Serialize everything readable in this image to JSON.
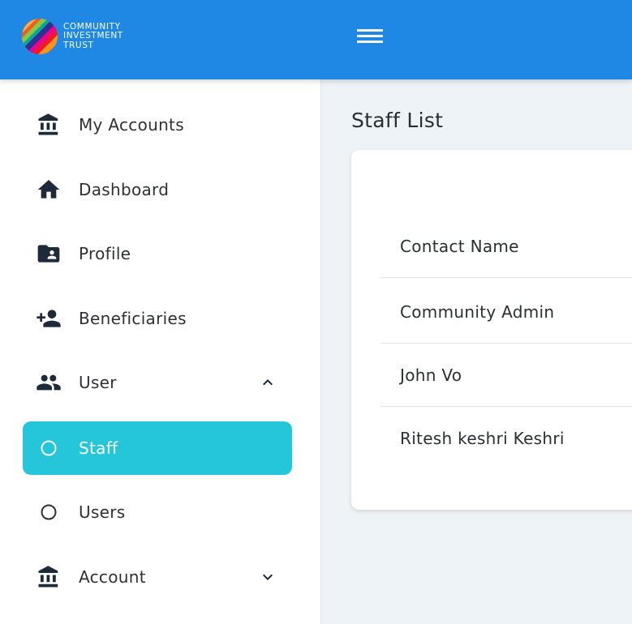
{
  "brand": {
    "line1": "COMMUNITY",
    "line2": "INVESTMENT",
    "line3": "TRUST"
  },
  "header": {
    "menu_icon": "hamburger-icon",
    "color": "#1f88e5"
  },
  "sidebar": {
    "items": [
      {
        "label": "My Accounts",
        "icon": "bank-icon"
      },
      {
        "label": "Dashboard",
        "icon": "home-icon"
      },
      {
        "label": "Profile",
        "icon": "folder-user-icon"
      },
      {
        "label": "Beneficiaries",
        "icon": "person-add-icon"
      },
      {
        "label": "User",
        "icon": "group-icon",
        "expanded": true
      },
      {
        "label": "Staff",
        "icon": "circle-icon",
        "active": true
      },
      {
        "label": "Users",
        "icon": "circle-icon"
      },
      {
        "label": "Account",
        "icon": "bank-icon",
        "expanded": false
      }
    ],
    "active_color": "#26c6da"
  },
  "main": {
    "title": "Staff List",
    "table": {
      "header": "Contact Name",
      "rows": [
        "Community Admin",
        "John Vo",
        "Ritesh keshri Keshri"
      ]
    }
  }
}
